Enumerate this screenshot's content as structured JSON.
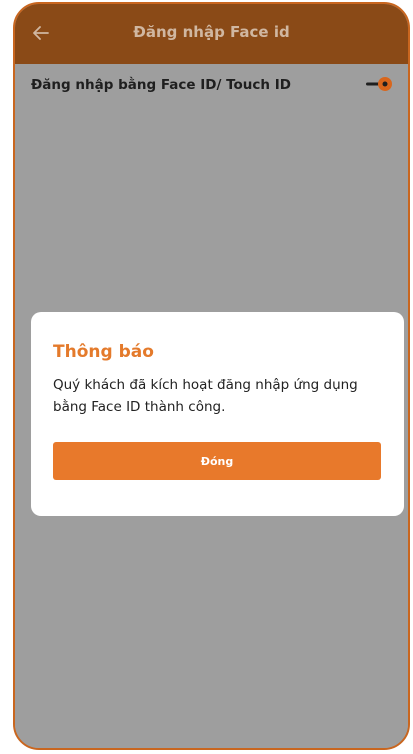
{
  "header": {
    "title": "Đăng nhập Face id",
    "back_icon": "arrow-left-icon"
  },
  "settings": {
    "face_id_label": "Đăng nhập bằng Face ID/ Touch ID",
    "face_id_enabled": true
  },
  "dialog": {
    "title": "Thông báo",
    "message": "Quý khách đã kích hoạt đăng nhập ứng dụng bằng Face ID thành công.",
    "close_label": "Đóng"
  },
  "colors": {
    "accent": "#e8792b",
    "header_bg": "#8a4a17",
    "overlay_bg": "#9e9e9e",
    "dialog_title": "#e47a2b"
  }
}
